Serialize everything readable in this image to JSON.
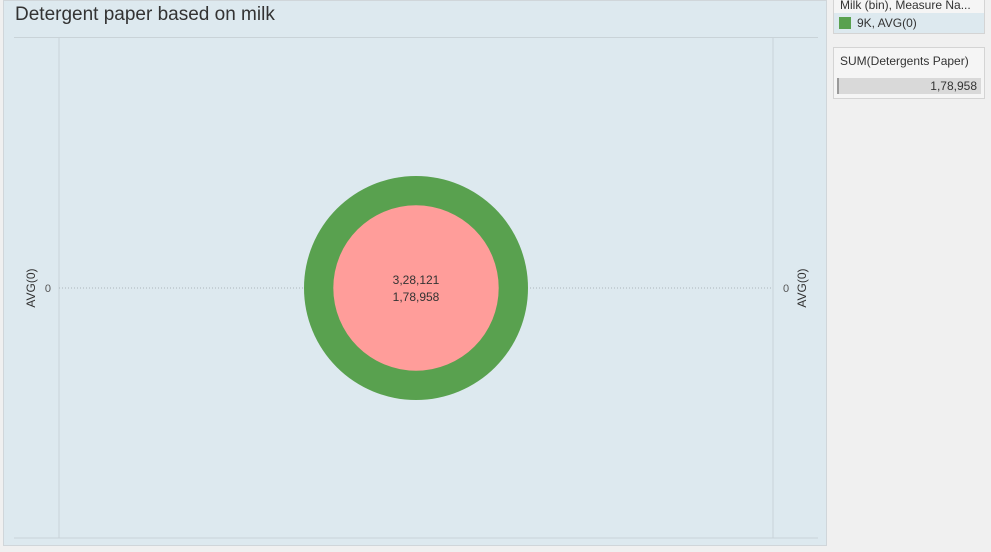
{
  "title": "Detergent paper based on milk",
  "legend": {
    "title": "Milk (bin), Measure Na...",
    "items": [
      {
        "label": "9K, AVG(0)",
        "color": "#59a14f"
      }
    ]
  },
  "size_legend": {
    "title": "SUM(Detergents Paper)",
    "value": "1,78,958"
  },
  "chart_data": {
    "type": "pie",
    "title": "Detergent paper based on milk",
    "y_axis_left": {
      "label": "AVG(0)",
      "ticks": [
        "0"
      ]
    },
    "y_axis_right": {
      "label": "AVG(0)",
      "ticks": [
        "0"
      ]
    },
    "rings": [
      {
        "role": "outer",
        "value": 328121,
        "label": "3,28,121",
        "color": "#59a14f"
      },
      {
        "role": "inner",
        "value": 178958,
        "label": "1,78,958",
        "color": "#ff9d9a"
      }
    ]
  }
}
